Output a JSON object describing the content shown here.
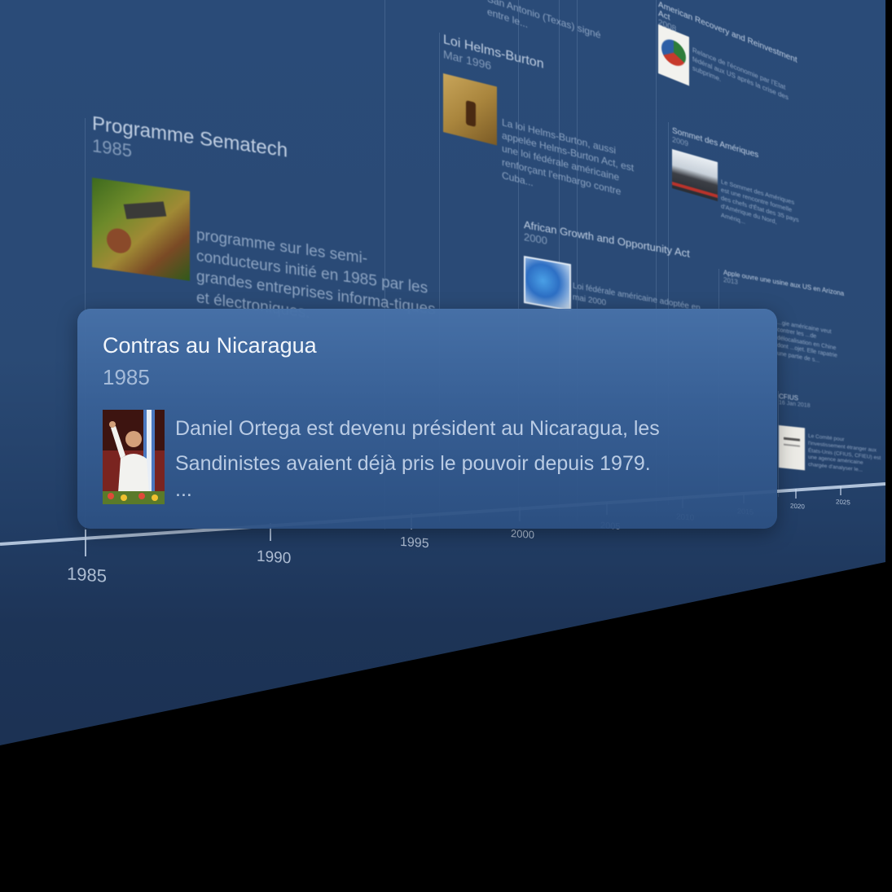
{
  "popup": {
    "title": "Contras au Nicaragua",
    "date": "1985",
    "description": "Daniel Ortega est devenu président au Nicaragua, les Sandinistes avaient déjà pris le pouvoir depuis 1979.",
    "ellipsis": "...",
    "photo_icon": "portrait-photo"
  },
  "axis": {
    "ticks": [
      "1985",
      "1990",
      "1995",
      "2000",
      "2005",
      "2010",
      "2015",
      "2020",
      "2025"
    ]
  },
  "events": [
    {
      "title": "Programme Sematech",
      "date": "1985",
      "description": "programme sur les semi-conducteurs initié en 1985 par les grandes entreprises informa-tiques et électroniques.",
      "image_icon": "circuit-board-photo"
    },
    {
      "title": "Loi Helms-Burton",
      "date": "Mar 1996",
      "description": "La loi Helms-Burton, aussi appelée Helms-Burton Act, est une loi fédérale américaine renforçant l'embargo contre Cuba...",
      "image_icon": "gavel-photo"
    },
    {
      "title": "African Growth and Opportunity Act",
      "date": "2000",
      "description": "Loi fédérale américaine adoptée en mai 2000",
      "image_icon": "globe-photo"
    },
    {
      "title": "American Recovery and Reinvestment Act",
      "date": "2008",
      "description": "Relance de l'économie par l'Etat fédéral aux US après la crise des subprime.",
      "image_icon": "seal-photo"
    },
    {
      "title": "Sommet des Amériques",
      "date": "2009",
      "description": "Le Sommet des Amériques est une rencontre formelle des chefs d'État des 35 pays d'Amérique du Nord, Amériq...",
      "image_icon": "group-photo"
    },
    {
      "title": "Apple ouvre une usine aux US en Arizona",
      "date": "2013",
      "description": "...gie américaine veut contrer les ...de délocalisation en Chine dont ...ojet. Elle rapatrie une partie de s...",
      "image_icon": "factory-photo"
    },
    {
      "title": "CFIUS",
      "date": "16 Jan 2018",
      "description": "Le Comité pour l'investissement étranger aux États-Unis (CFIUS, CFIEU) est une agence américaine chargée d'analyser le...",
      "image_icon": "document-photo"
    },
    {
      "title": "",
      "date": "",
      "description": "San Antonio (Texas) signé entre le...",
      "image_icon": ""
    }
  ],
  "colors": {
    "wall_top": "#2a4b78",
    "wall_bottom": "#1a2f50",
    "popup_top": "#4771a8",
    "popup_bottom": "#2c5082",
    "axis_line": "#c9d9ef"
  }
}
